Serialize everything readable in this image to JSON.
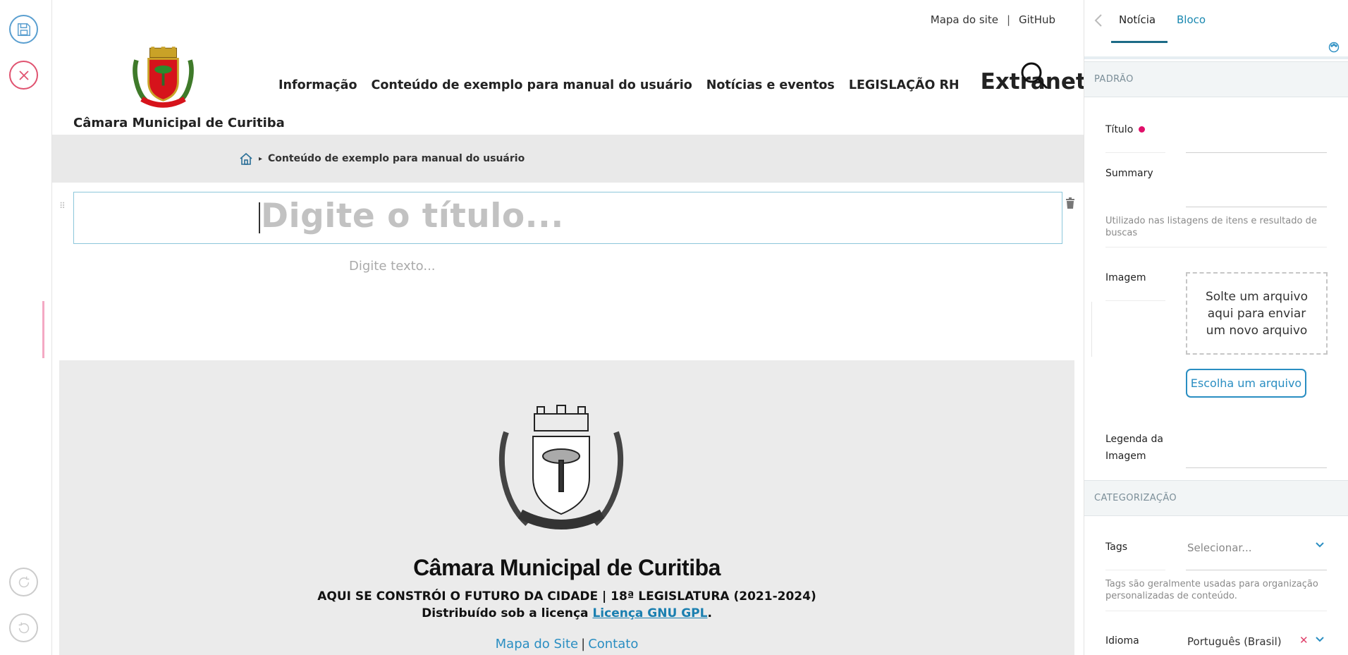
{
  "top_links": {
    "sitemap": "Mapa do site",
    "separator": "|",
    "github": "GitHub"
  },
  "site": {
    "name": "Câmara Municipal de Curitiba"
  },
  "nav": {
    "items": [
      "Informação",
      "Conteúdo de exemplo para manual do usuário",
      "Notícias e eventos",
      "LEGISLAÇÃO RH"
    ],
    "extranet": "Extranet"
  },
  "breadcrumb": {
    "separator": "▸",
    "current": "Conteúdo de exemplo para manual do usuário"
  },
  "editor": {
    "title_placeholder": "Digite o título...",
    "text_placeholder": "Digite texto..."
  },
  "footer": {
    "org_name": "Câmara Municipal de Curitiba",
    "tagline": "AQUI SE CONSTRÓI O FUTURO DA CIDADE | 18ª LEGISLATURA (2021-2024)",
    "license_prefix": "Distribuído sob a licença ",
    "license_link": "Licença GNU GPL",
    "license_suffix": ".",
    "links": {
      "sitemap": "Mapa do Site",
      "separator": "|",
      "contact": "Contato"
    }
  },
  "sidebar": {
    "tabs": {
      "noticia": "Notícia",
      "bloco": "Bloco"
    },
    "section_default": "PADRÃO",
    "section_categorization": "CATEGORIZAÇÃO",
    "fields": {
      "titulo": "Título",
      "summary": "Summary",
      "summary_help": "Utilizado nas listagens de itens e resultado de buscas",
      "imagem": "Imagem",
      "dropzone": "Solte um arquivo aqui para enviar um novo arquivo",
      "choose_file": "Escolha um arquivo",
      "legenda_line1": "Legenda da",
      "legenda_line2": "Imagem",
      "tags": "Tags",
      "tags_placeholder": "Selecionar...",
      "tags_help": "Tags são geralmente usadas para organização personalizadas de conteúdo.",
      "idioma": "Idioma",
      "idioma_value": "Português (Brasil)",
      "idioma_clear": "✕"
    }
  },
  "colors": {
    "accent": "#2a8ec2",
    "required": "#e0106a",
    "cancel": "#e05370",
    "save": "#5a9fd0",
    "footer_bg": "#ebebeb"
  },
  "icons": [
    "save-icon",
    "close-icon",
    "redo-icon",
    "undo-icon",
    "search-icon",
    "home-icon",
    "trash-icon",
    "drag-handle-icon",
    "chevron-left-icon",
    "palette-icon",
    "chevron-down-icon",
    "coat-of-arms-logo"
  ]
}
